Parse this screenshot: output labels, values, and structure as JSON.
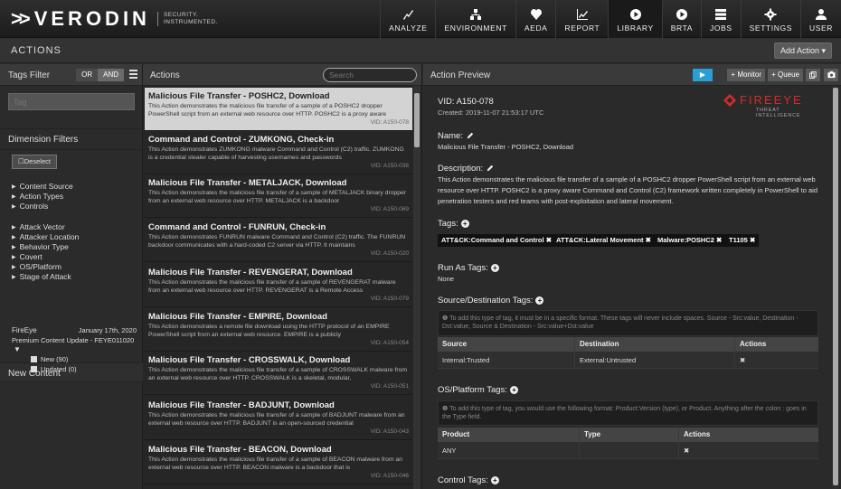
{
  "brand": {
    "logo_text": "VERODIN",
    "tagline": "SECURITY.\nINSTRUMENTED."
  },
  "nav": [
    {
      "label": "ANALYZE",
      "icon": "analyze-icon"
    },
    {
      "label": "ENVIRONMENT",
      "icon": "environment-icon"
    },
    {
      "label": "AEDA",
      "icon": "aeda-icon"
    },
    {
      "label": "REPORT",
      "icon": "report-icon"
    },
    {
      "label": "LIBRARY",
      "icon": "library-icon"
    },
    {
      "label": "BRTA",
      "icon": "brta-icon"
    },
    {
      "label": "JOBS",
      "icon": "jobs-icon"
    },
    {
      "label": "SETTINGS",
      "icon": "settings-icon"
    },
    {
      "label": "USER",
      "icon": "user-icon"
    }
  ],
  "actions_bar": {
    "title": "ACTIONS",
    "add_action": "Add Action ▾"
  },
  "tags_filter": {
    "title": "Tags Filter",
    "or": "OR",
    "and": "AND",
    "placeholder": "Tag"
  },
  "dimension_filters": {
    "title": "Dimension Filters",
    "deselect": "Deselect",
    "group1": [
      "Content Source",
      "Action Types",
      "Controls"
    ],
    "group2": [
      "Attack Vector",
      "Attacker Location",
      "Behavior Type",
      "Covert",
      "OS/Platform",
      "Stage of Attack"
    ]
  },
  "new_content": {
    "title": "New Content",
    "source": "FireEye",
    "date": "January 17th, 2020",
    "update": "Premium Content Update - FEYE011020",
    "new_label": "New (90)",
    "updated_label": "Updated (0)"
  },
  "actions_panel": {
    "title": "Actions",
    "search_placeholder": "Search"
  },
  "actions": [
    {
      "title": "Malicious File Transfer - POSHC2, Download",
      "desc": "This Action demonstrates the malicious file transfer of a sample of a POSHC2 dropper PowerShell script from an external web resource over HTTP. POSHC2 is a proxy aware",
      "vid": "VID: A150-078"
    },
    {
      "title": "Command and Control - ZUMKONG, Check-in",
      "desc": "This Action demonstrates ZUMKONG malware Command and Control (C2) traffic. ZUMKONG is a credential stealer capable of harvesting usernames and passwords",
      "vid": "VID: A150-038"
    },
    {
      "title": "Malicious File Transfer - METALJACK, Download",
      "desc": "This Action demonstrates the malicious file transfer of a sample of METALJACK binary dropper from an external web resource over HTTP. METALJACK is a backdoor",
      "vid": "VID: A150-069"
    },
    {
      "title": "Command and Control - FUNRUN, Check-in",
      "desc": "This Action demonstrates FUNRUN malware Command and Control (C2) traffic. The FUNRUN backdoor communicates with a hard-coded C2 server via HTTP. It maintains",
      "vid": "VID: A150-020"
    },
    {
      "title": "Malicious File Transfer - REVENGERAT, Download",
      "desc": "This Action demonstrates the malicious file transfer of a sample of REVENGERAT malware from an external web resource over HTTP. REVENGERAT is a Remote Access",
      "vid": "VID: A150-079"
    },
    {
      "title": "Malicious File Transfer - EMPIRE, Download",
      "desc": "This Action demonstrates a remote file download using the HTTP protocol of an EMPIRE PowerShell script from an external web resource. EMPIRE is a publicly",
      "vid": "VID: A150-054"
    },
    {
      "title": "Malicious File Transfer - CROSSWALK, Download",
      "desc": "This Action demonstrates the malicious file transfer of a sample of CROSSWALK malware from an external web resource over HTTP. CROSSWALK is a skeletal, modular,",
      "vid": "VID: A150-051"
    },
    {
      "title": "Malicious File Transfer - BADJUNT, Download",
      "desc": "This Action demonstrates the malicious file transfer of a sample of BADJUNT malware from an external web resource over HTTP. BADJUNT is an open-sourced credential",
      "vid": "VID: A150-043"
    },
    {
      "title": "Malicious File Transfer - BEACON, Download",
      "desc": "This Action demonstrates the malicious file transfer of a sample of BEACON malware from an external web resource over HTTP. BEACON malware is a backdoor that is",
      "vid": "VID: A150-046"
    }
  ],
  "preview": {
    "title": "Action Preview",
    "monitor": "+ Monitor",
    "queue": "+ Queue",
    "vid": "VID: A150-078",
    "created": "Created: 2019-11-07 21:53:17 UTC",
    "vendor": "FIREEYE",
    "vendor_sub": "THREAT INTELLIGENCE",
    "name_label": "Name:",
    "name_value": "Malicious File Transfer - POSHC2, Download",
    "desc_label": "Description:",
    "desc_value": "This Action demonstrates the malicious file transfer of a sample of a POSHC2 dropper PowerShell script from an external web resource over HTTP. POSHC2 is a proxy aware Command and Control (C2) framework written completely in PowerShell to aid penetration testers and red teams with post-exploitation and lateral movement.",
    "tags_label": "Tags:",
    "tags": [
      "ATT&CK:Command and Control",
      "ATT&CK:Lateral Movement",
      "Malware:POSHC2",
      "T1105"
    ],
    "runas_label": "Run As Tags:",
    "runas_value": "None",
    "srcdst_label": "Source/Destination Tags:",
    "srcdst_info": "To add this type of tag, it must be in a specific format. These tags will never include spaces. Source - Src:value, Destination - Dst:value, Source & Destination - Src:value+Dst:value",
    "srcdst_headers": [
      "Source",
      "Destination",
      "Actions"
    ],
    "srcdst_row": [
      "Internal:Trusted",
      "External:Untrusted"
    ],
    "os_label": "OS/Platform Tags:",
    "os_info": "To add this type of tag, you would use the following format: Product:Version (type), or Product. Anything after the colon : goes in the Type field.",
    "os_headers": [
      "Product",
      "Type",
      "Actions"
    ],
    "os_row": [
      "ANY",
      ""
    ],
    "control_label": "Control Tags:"
  }
}
